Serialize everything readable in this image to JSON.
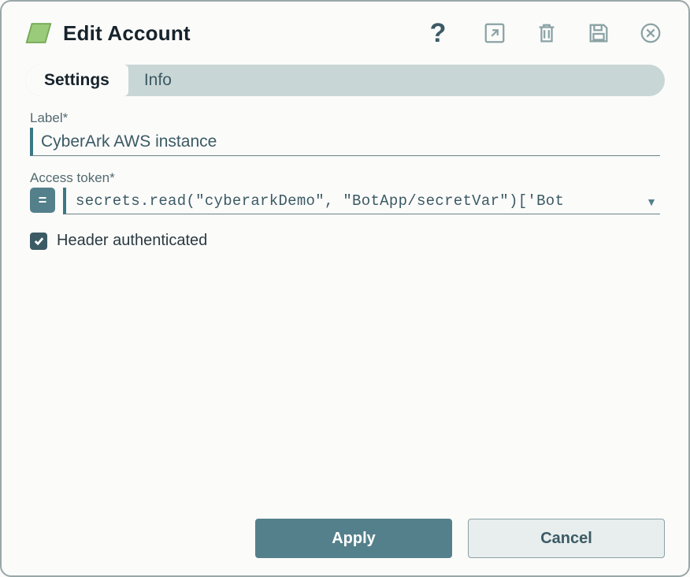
{
  "header": {
    "title": "Edit Account"
  },
  "tabs": [
    {
      "label": "Settings",
      "active": true
    },
    {
      "label": "Info",
      "active": false
    }
  ],
  "form": {
    "label_field_label": "Label*",
    "label_value": "CyberArk AWS instance",
    "access_token_label": "Access token*",
    "access_token_value": "secrets.read(\"cyberarkDemo\", \"BotApp/secretVar\")['Bot",
    "equals_symbol": "=",
    "header_auth_label": "Header authenticated",
    "header_auth_checked": true
  },
  "footer": {
    "apply_label": "Apply",
    "cancel_label": "Cancel"
  },
  "colors": {
    "accent": "#54808b",
    "border_accent": "#3b7885",
    "icon_muted": "#8aa2a4"
  }
}
